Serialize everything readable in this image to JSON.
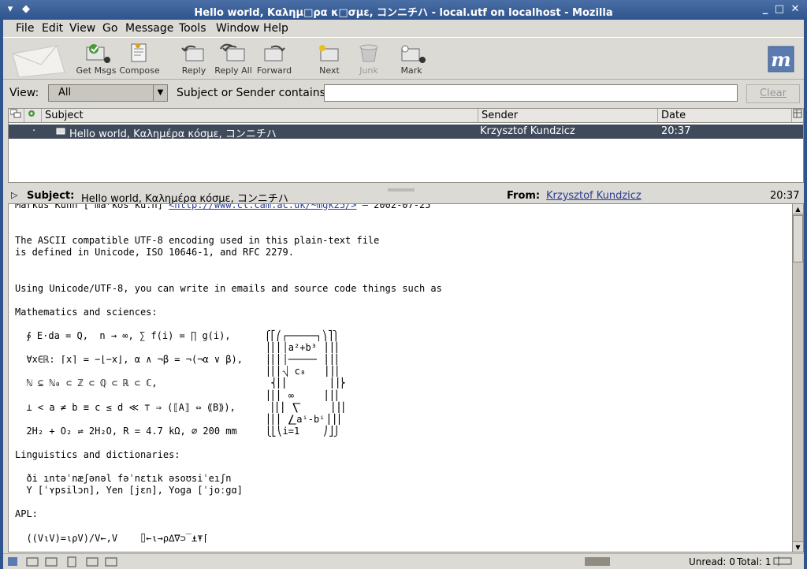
{
  "window": {
    "title": "Hello world, Καλημ□ρα κ□σμε, コンニチハ - local.utf on localhost - Mozilla",
    "accent": "#3a5f99"
  },
  "menu": [
    "File",
    "Edit",
    "View",
    "Go",
    "Message",
    "Tools",
    "Window",
    "Help"
  ],
  "toolbar": {
    "get_msgs": "Get Msgs",
    "compose": "Compose",
    "reply": "Reply",
    "reply_all": "Reply All",
    "forward": "Forward",
    "next": "Next",
    "junk": "Junk",
    "mark": "Mark"
  },
  "viewbar": {
    "view_label": "View:",
    "view_value": "All",
    "search_label": "Subject or Sender contains:",
    "search_value": "",
    "clear_label": "Clear"
  },
  "thread_columns": [
    "Subject",
    "Sender",
    "Date"
  ],
  "messages": [
    {
      "subject": "Hello world, Καλημέρα κόσμε, コンニチハ",
      "sender": "Krzysztof Kundzicz",
      "date": "20:37"
    }
  ],
  "message_header": {
    "subject_label": "Subject:",
    "subject": "Hello world, Καλημέρα κόσμε, コンニチハ",
    "from_label": "From:",
    "from": "Krzysztof Kundzicz",
    "time": "20:37"
  },
  "body_lines": [
    "Markus Kuhn [ˈmaʳkʊs kuːn] <http://www.cl.cam.ac.uk/~mgk25/> — 2002-07-25",
    "",
    "",
    "The ASCII compatible UTF-8 encoding used in this plain-text file",
    "is defined in Unicode, ISO 10646-1, and RFC 2279.",
    "",
    "",
    "Using Unicode/UTF-8, you can write in emails and source code things such as",
    "",
    "Mathematics and sciences:",
    "",
    "  ∮ E⋅da = Q,  n → ∞, ∑ f(i) = ∏ g(i),      ⎧⎡⎛┌─────┐⎞⎤⎫",
    "                                            ⎪⎢⎜│a²+b³ ⎟⎥⎪",
    "  ∀x∈ℝ: ⌈x⌉ = −⌊−x⌋, α ∧ ¬β = ¬(¬α ∨ β),    ⎪⎢⎜│───── ⎟⎥⎪",
    "                                            ⎪⎢⎜⎷ c₈   ⎟⎥⎪",
    "  ℕ ⊆ ℕ₀ ⊂ ℤ ⊂ ℚ ⊂ ℝ ⊂ ℂ,                    ⎨⎢⎜       ⎟⎥⎬",
    "                                            ⎪⎢⎜ ∞     ⎟⎥⎪",
    "  ⊥ < a ≠ b ≡ c ≤ d ≪ ⊤ ⇒ (⟦A⟧ ⇔ ⟪B⟫),      ⎪⎢⎜ ⎲     ⎟⎥⎪",
    "                                            ⎪⎢⎜ ⎳aⁱ-bⁱ⎟⎥⎪",
    "  2H₂ + O₂ ⇌ 2H₂O, R = 4.7 kΩ, ⌀ 200 mm     ⎩⎣⎝i=1    ⎠⎦⎭",
    "",
    "Linguistics and dictionaries:",
    "",
    "  ði ıntəˈnæʃənəl fəˈnɛtık əsoʊsiˈeıʃn",
    "  Y [ˈʏpsilɔn], Yen [jɛn], Yoga [ˈjoːgɑ]",
    "",
    "APL:",
    "",
    "  ((V⍳V)=⍳⍴V)/V←,V    ⌷←⍳→⍴∆∇⊃‾⍎⍕⌈"
  ],
  "status": {
    "unread": "Unread: 0",
    "total": "Total: 1"
  }
}
